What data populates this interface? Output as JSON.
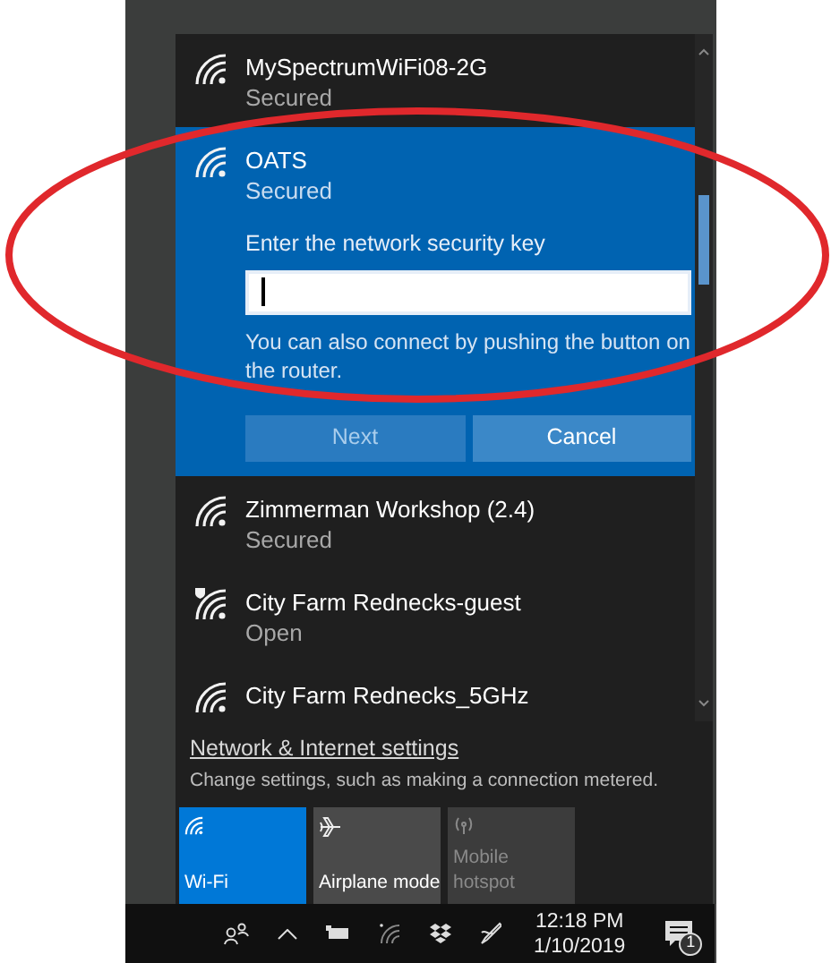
{
  "networks": [
    {
      "name": "MySpectrumWiFi08-2G",
      "status": "Secured",
      "kind": "secured",
      "selected": false
    },
    {
      "name": "OATS",
      "status": "Secured",
      "kind": "secured",
      "selected": true,
      "connect_form": {
        "label": "Enter the network security key",
        "hint": "You can also connect by pushing the button on the router.",
        "buttons": [
          {
            "label": "Next",
            "disabled": true
          },
          {
            "label": "Cancel",
            "disabled": false
          }
        ]
      }
    },
    {
      "name": "Zimmerman Workshop (2.4)",
      "status": "Secured",
      "kind": "secured",
      "selected": false
    },
    {
      "name": "City Farm Rednecks-guest",
      "status": "Open",
      "kind": "open",
      "selected": false
    },
    {
      "name": "City Farm Rednecks_5GHz",
      "kind": "secured",
      "selected": false
    }
  ],
  "settings": {
    "link": "Network & Internet settings",
    "description": "Change settings, such as making a connection metered."
  },
  "quick_actions": [
    {
      "label": "Wi-Fi",
      "kind": "wifi",
      "on": true,
      "disabled": false
    },
    {
      "label": "Airplane mode",
      "kind": "airplane",
      "on": false,
      "disabled": false
    },
    {
      "label": "Mobile hotspot",
      "kind": "hotspot",
      "on": false,
      "disabled": true
    }
  ],
  "taskbar": {
    "time": "12:18 PM",
    "date": "1/10/2019",
    "notification_count": "1"
  }
}
